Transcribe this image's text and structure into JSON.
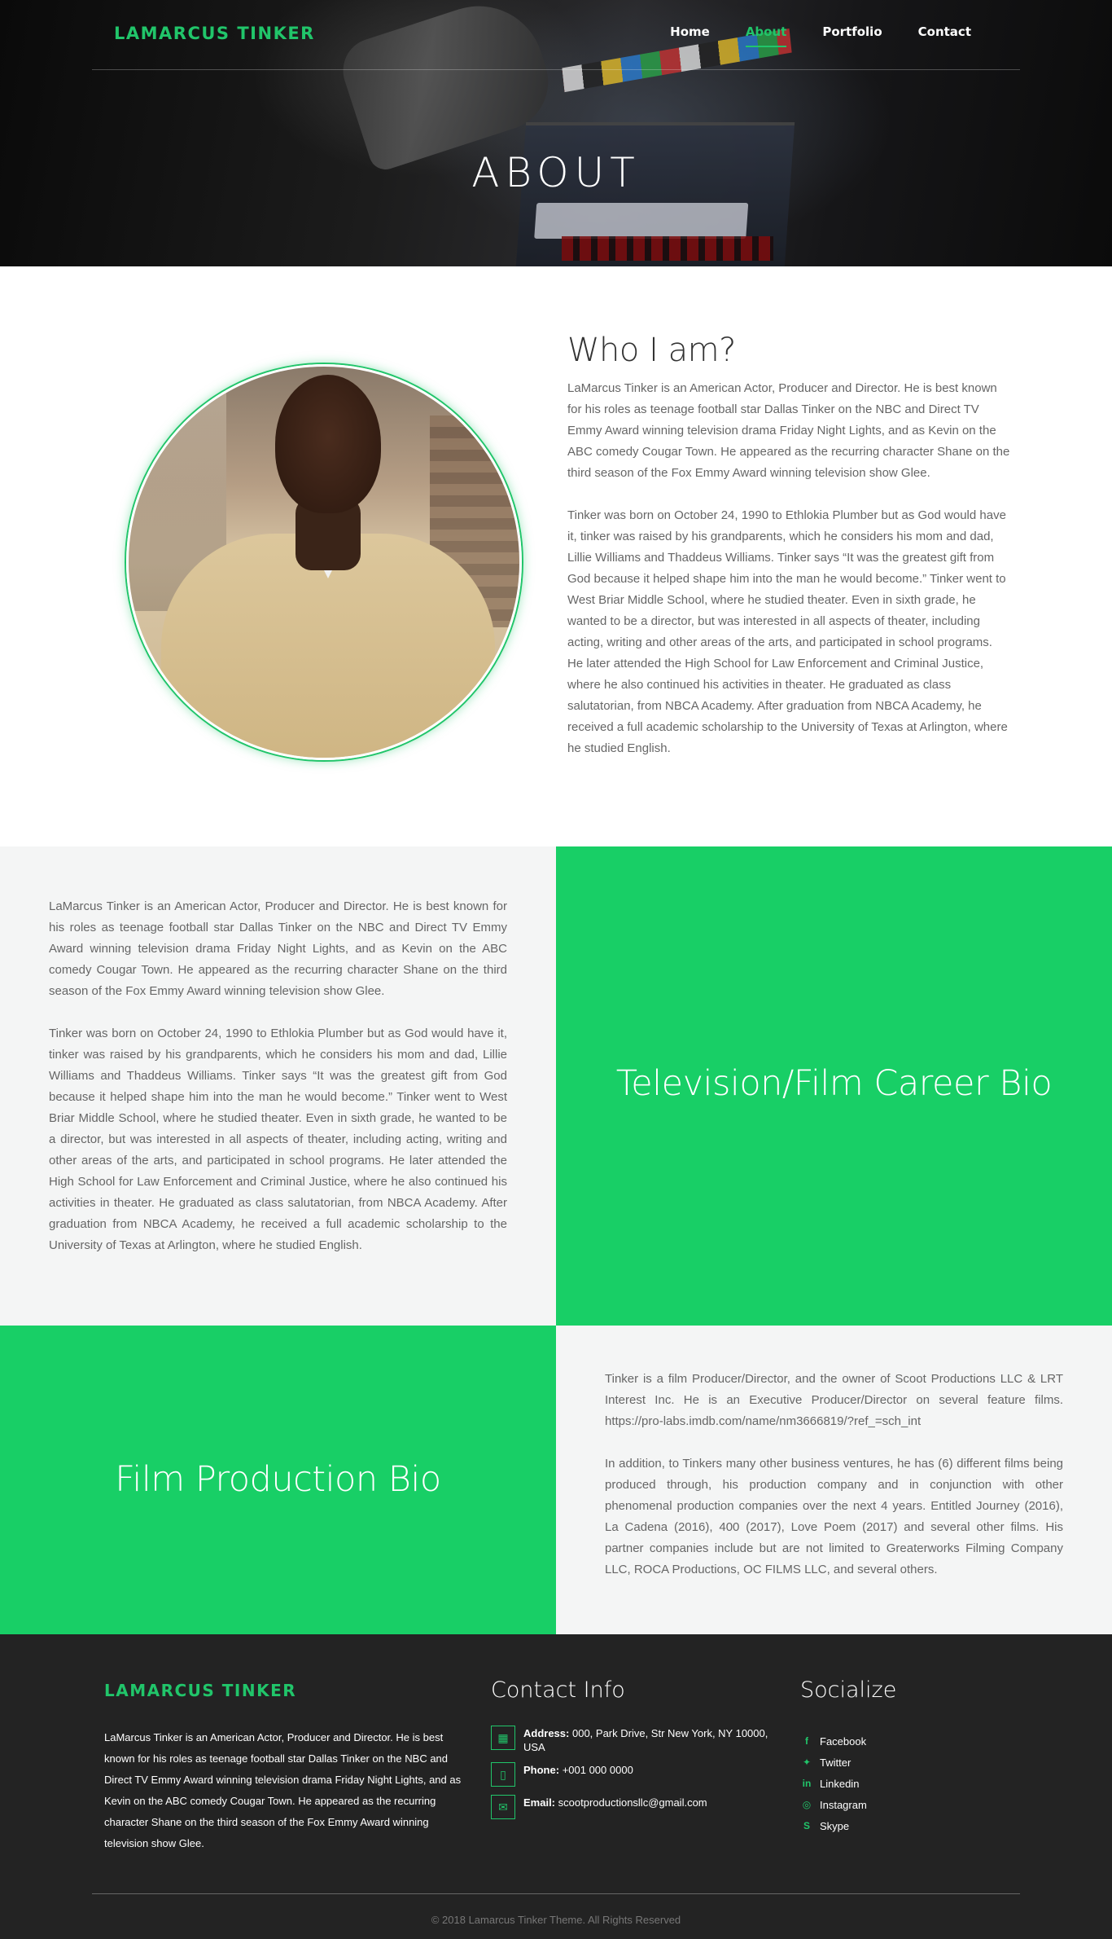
{
  "brand": {
    "name": "LAMARCUS TINKER",
    "accent": "#21c56a",
    "green_panel": "#18cf66"
  },
  "nav": {
    "items": [
      {
        "label": "Home",
        "active": false
      },
      {
        "label": "About",
        "active": true
      },
      {
        "label": "Portfolio",
        "active": false
      },
      {
        "label": "Contact",
        "active": false
      }
    ]
  },
  "hero": {
    "title": "ABOUT"
  },
  "who": {
    "title": "Who I am?",
    "paragraphs": [
      "LaMarcus Tinker is an American Actor, Producer and Director. He is best known for his roles as teenage football star Dallas Tinker on the NBC and Direct TV Emmy Award winning television drama Friday Night Lights, and as Kevin on the ABC comedy Cougar Town. He appeared as the recurring character Shane on the third season of the Fox Emmy Award winning television show Glee.",
      "Tinker was born on October 24, 1990 to Ethlokia Plumber but as God would have it, tinker was raised by his grandparents, which he considers his mom and dad, Lillie Williams and Thaddeus Williams. Tinker says “It was the greatest gift from God because it helped shape him into the man he would become.” Tinker went to West Briar Middle School, where he studied theater. Even in sixth grade, he wanted to be a director, but was interested in all aspects of theater, including acting, writing and other areas of the arts, and participated in school programs. He later attended the High School for Law Enforcement and Criminal Justice, where he also continued his activities in theater. He graduated as class salutatorian, from NBCA Academy. After graduation from NBCA Academy, he received a full academic scholarship to the University of Texas at Arlington, where he studied English."
    ]
  },
  "career": {
    "title": "Television/Film Career Bio",
    "paragraphs": [
      "LaMarcus Tinker is an American Actor, Producer and Director. He is best known for his roles as teenage football star Dallas Tinker on the NBC and Direct TV Emmy Award winning television drama Friday Night Lights, and as Kevin on the ABC comedy Cougar Town. He appeared as the recurring character Shane on the third season of the Fox Emmy Award winning television show Glee.",
      "Tinker was born on October 24, 1990 to Ethlokia Plumber but as God would have it, tinker was raised by his grandparents, which he considers his mom and dad, Lillie Williams and Thaddeus Williams. Tinker says “It was the greatest gift from God because it helped shape him into the man he would become.” Tinker went to West Briar Middle School, where he studied theater. Even in sixth grade, he wanted to be a director, but was interested in all aspects of theater, including acting, writing and other areas of the arts, and participated in school programs. He later attended the High School for Law Enforcement and Criminal Justice, where he also continued his activities in theater. He graduated as class salutatorian, from NBCA Academy. After graduation from NBCA Academy, he received a full academic scholarship to the University of Texas at Arlington, where he studied English."
    ]
  },
  "production": {
    "title": "Film Production Bio",
    "paragraphs": [
      "Tinker is a film Producer/Director, and the owner of Scoot Productions LLC & LRT Interest Inc. He is an Executive Producer/Director on several feature films. https://pro-labs.imdb.com/name/nm3666819/?ref_=sch_int",
      "In addition, to Tinkers many other business ventures, he has (6) different films being produced through, his production company and in conjunction with other phenomenal production companies over the next 4 years. Entitled Journey (2016), La Cadena (2016), 400 (2017), Love Poem (2017) and several other films. His partner companies include but are not limited to Greaterworks Filming Company LLC, ROCA Productions, OC FILMS LLC, and several others."
    ]
  },
  "footer": {
    "brand": "LAMARCUS TINKER",
    "about": "LaMarcus Tinker is an American Actor, Producer and Director. He is best known for his roles as teenage football star Dallas Tinker on the NBC and Direct TV Emmy Award winning television drama Friday Night Lights, and as Kevin on the ABC comedy Cougar Town. He appeared as the recurring character Shane on the third season of the Fox Emmy Award winning television show Glee.",
    "contact": {
      "heading": "Contact Info",
      "items": [
        {
          "icon": "map-icon",
          "label": "Address:",
          "value": "000, Park Drive, Str New York, NY 10000, USA"
        },
        {
          "icon": "phone-icon",
          "label": "Phone:",
          "value": "+001 000 0000"
        },
        {
          "icon": "mail-icon",
          "label": "Email:",
          "value": "scootproductionsllc@gmail.com"
        }
      ]
    },
    "social": {
      "heading": "Socialize",
      "items": [
        {
          "icon": "facebook-icon",
          "label": "Facebook"
        },
        {
          "icon": "twitter-icon",
          "label": "Twitter"
        },
        {
          "icon": "linkedin-icon",
          "label": "Linkedin"
        },
        {
          "icon": "instagram-icon",
          "label": "Instagram"
        },
        {
          "icon": "skype-icon",
          "label": "Skype"
        }
      ]
    },
    "copyright": "© 2018 Lamarcus Tinker Theme. All Rights Reserved"
  }
}
